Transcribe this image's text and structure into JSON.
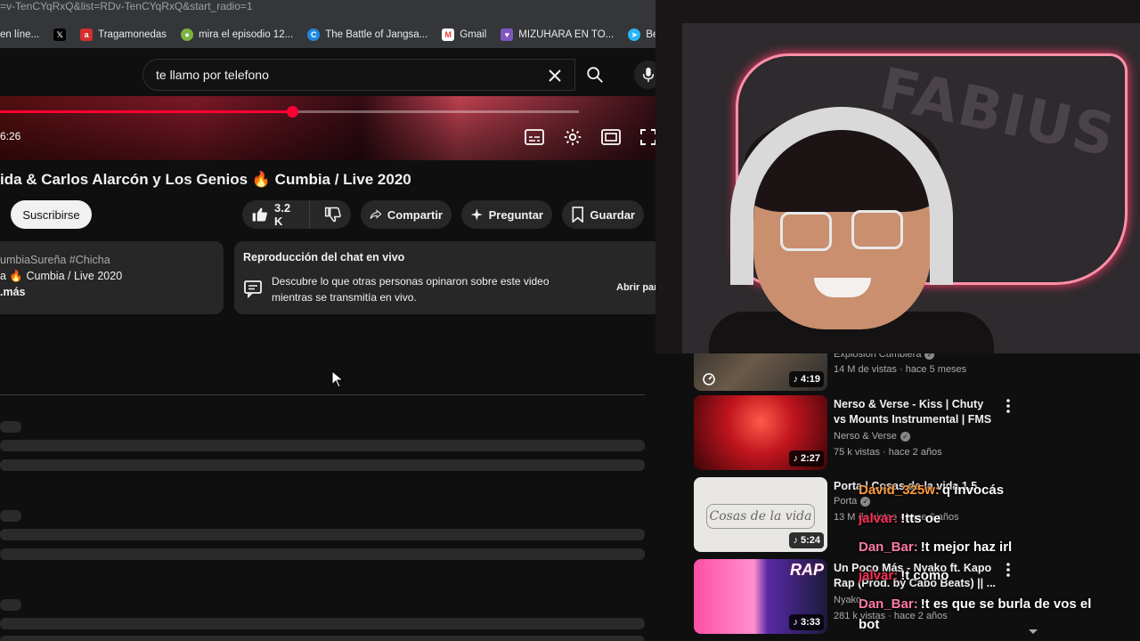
{
  "browser": {
    "url": "=v-TenCYqRxQ&list=RDv-TenCYqRxQ&start_radio=1",
    "bookmarks": [
      {
        "label": "en líne...",
        "icon": "bookmark-icon",
        "color": "#1a73e8"
      },
      {
        "label": "",
        "icon": "x-twitter-icon",
        "color": "#000000"
      },
      {
        "label": "Tragamonedas",
        "icon": "casino-icon",
        "color": "#d32f2f"
      },
      {
        "label": "mira el episodio 12...",
        "icon": "anime-icon",
        "color": "#7cb342"
      },
      {
        "label": "The Battle of Jangsa...",
        "icon": "edge-icon",
        "color": "#1e88e5"
      },
      {
        "label": "Gmail",
        "icon": "gmail-icon",
        "color": "#ea4335"
      },
      {
        "label": "MIZUHARA EN TO...",
        "icon": "heart-icon",
        "color": "#7e57c2"
      },
      {
        "label": "Beatrice-R",
        "icon": "telegram-icon",
        "color": "#29b6f6"
      }
    ]
  },
  "search": {
    "query": "te llamo por telefono"
  },
  "player": {
    "time": "6:26",
    "progress": 0.505
  },
  "video": {
    "title": "ida & Carlos Alarcón y Los Genios 🔥 Cumbia / Live 2020",
    "subscribe_label": "Suscribirse",
    "likes": "3.2 K",
    "share_label": "Compartir",
    "ask_label": "Preguntar",
    "save_label": "Guardar"
  },
  "description": {
    "tags": "umbiaSureña #Chicha",
    "line2": "a 🔥 Cumbia / Live 2020",
    "more": ".más"
  },
  "live_chat_replay": {
    "title": "Reproducción del chat en vivo",
    "body": "Descubre lo que otras personas opinaron sobre este video mientras se transmitía en vivo.",
    "open_label": "Abrir pan"
  },
  "recommendations": [
    {
      "title": "",
      "channel": "Explosión Cumbiera",
      "meta": "14 M de vistas · hace 5 meses",
      "duration": "4:19"
    },
    {
      "title": "Nerso & Verse - Kiss | Chuty vs Mounts Instrumental | FMS ...",
      "channel": "Nerso & Verse",
      "meta": "75 k vistas · hace 2 años",
      "duration": "2:27"
    },
    {
      "title": "Porta | Cosas de la vida 1.5",
      "channel": "Porta",
      "meta": "13 M de vistas · hace 6 años",
      "duration": "5:24",
      "thumb_text": "Cosas de la vida"
    },
    {
      "title": "Un Poco Más - Nyako ft. Kapo Rap (Prod. by Cabo Beats) || ...",
      "channel": "Nyako",
      "meta": "281 k vistas · hace 2 años",
      "duration": "3:33",
      "thumb_text": "RAP"
    }
  ],
  "stream_chat": [
    {
      "user": "David_325w:",
      "msg": "q invocás",
      "color": "#ff9a3c"
    },
    {
      "user": "jalvar:",
      "msg": "!tts oe",
      "color": "#ff2d55"
    },
    {
      "user": "Dan_Bar:",
      "msg": "!t mejor haz irl",
      "color": "#ff7aa8"
    },
    {
      "user": "jalvar:",
      "msg": "!t como",
      "color": "#ff2d55"
    },
    {
      "user": "Dan_Bar:",
      "msg": "!t es que se burla de vos el",
      "color": "#ff7aa8"
    },
    {
      "user": "",
      "msg": "bot",
      "color": "#ffffff"
    }
  ],
  "webcam": {
    "logo_text": "FABIUS"
  }
}
